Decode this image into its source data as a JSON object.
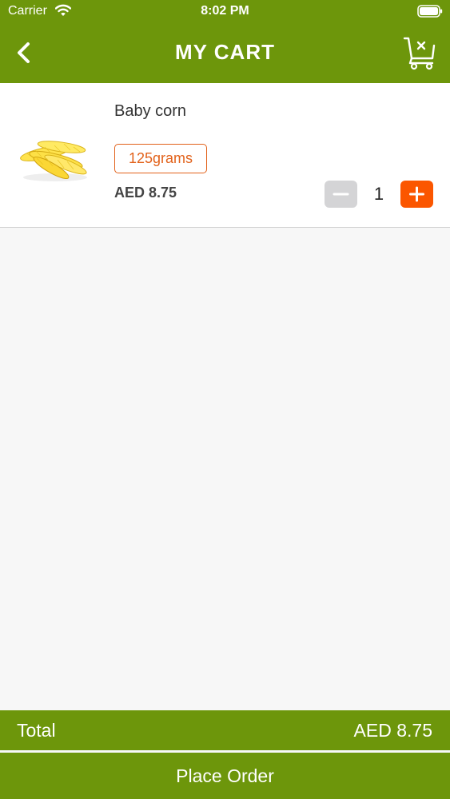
{
  "status_bar": {
    "carrier": "Carrier",
    "time": "8:02 PM"
  },
  "header": {
    "title": "MY CART",
    "back_icon": "chevron-left-icon",
    "clear_icon": "cart-clear-icon"
  },
  "cart": {
    "items": [
      {
        "name": "Baby corn",
        "weight": "125grams",
        "price": "AED 8.75",
        "quantity": "1",
        "image": "baby-corn-image"
      }
    ]
  },
  "footer": {
    "total_label": "Total",
    "total_amount": "AED 8.75",
    "place_order_label": "Place Order"
  },
  "colors": {
    "primary_green": "#6d960b",
    "accent_orange": "#fb5600",
    "badge_orange": "#e2621b",
    "minus_gray": "#d4d4d6"
  }
}
